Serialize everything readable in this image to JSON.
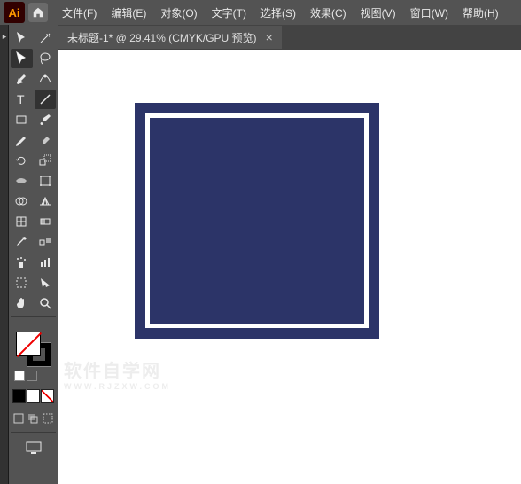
{
  "app": {
    "icon_text": "Ai"
  },
  "menu": {
    "items": [
      {
        "label": "文件(F)"
      },
      {
        "label": "编辑(E)"
      },
      {
        "label": "对象(O)"
      },
      {
        "label": "文字(T)"
      },
      {
        "label": "选择(S)"
      },
      {
        "label": "效果(C)"
      },
      {
        "label": "视图(V)"
      },
      {
        "label": "窗口(W)"
      },
      {
        "label": "帮助(H)"
      }
    ]
  },
  "document": {
    "tab_label": "未标题-1* @ 29.41% (CMYK/GPU 预览)",
    "close": "×"
  },
  "tools": {
    "row0": [
      "selection",
      "direct-selection"
    ],
    "row1": [
      "magic-wand",
      "lasso"
    ],
    "row2": [
      "pen",
      "curvature"
    ],
    "row3": [
      "type",
      "line-segment"
    ],
    "row4": [
      "rectangle",
      "paintbrush"
    ],
    "row5": [
      "shaper",
      "eraser"
    ],
    "row6": [
      "rotate",
      "scale"
    ],
    "row7": [
      "width",
      "free-transform"
    ],
    "row8": [
      "shape-builder",
      "perspective"
    ],
    "row9": [
      "mesh",
      "gradient"
    ],
    "row10": [
      "eyedropper",
      "blend"
    ],
    "row11": [
      "symbol-sprayer",
      "column-graph"
    ],
    "row12": [
      "artboard",
      "slice"
    ],
    "row13": [
      "hand",
      "zoom"
    ]
  },
  "colors": {
    "fill": "none",
    "stroke": "#000000",
    "swatch1": "#000000",
    "swatch2": "#ffffff",
    "swatch3_none": true
  },
  "artwork": {
    "outer_color": "#2c3468",
    "inner_stroke": "#ffffff"
  },
  "watermark": {
    "text": "软件自学网",
    "sub": "WWW.RJZXW.COM"
  }
}
